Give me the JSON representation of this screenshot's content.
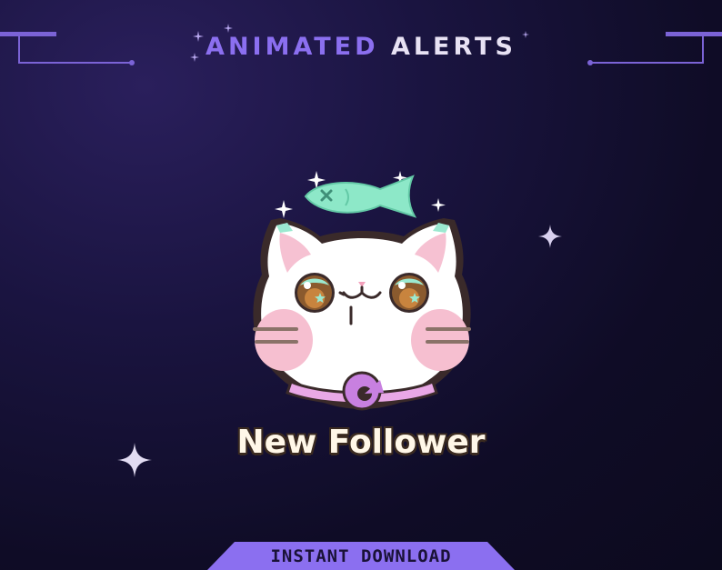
{
  "header": {
    "title_part1": "ANIMATED",
    "title_part2": "ALERTS"
  },
  "alert": {
    "text": "New Follower",
    "mascot": "white-cat-with-fish-icon"
  },
  "banner": {
    "label": "INSTANT DOWNLOAD"
  },
  "colors": {
    "accent": "#7b63d6",
    "title_primary": "#8b6ff0",
    "title_secondary": "#e8e2f4",
    "banner": "#8b6ff0",
    "background": "#14103a"
  }
}
